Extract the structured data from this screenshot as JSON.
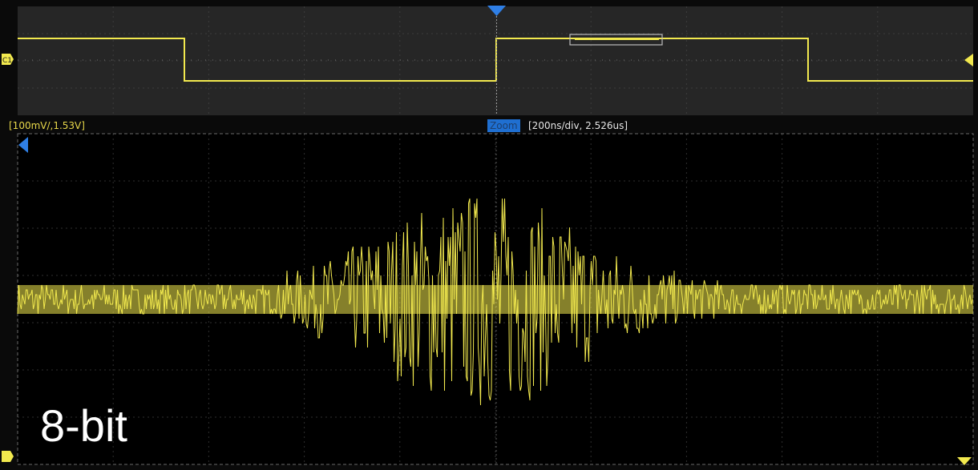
{
  "overview": {
    "marker_label": "",
    "channel_tag": "C1"
  },
  "zoom_header": {
    "channel_scale": "[100mV/,1.53V]",
    "zoom_label": "Zoom",
    "timebase": "[200ns/div, 2.526us]"
  },
  "annotation": {
    "bit_depth": "8-bit"
  },
  "colors": {
    "trace": "#f2e94e",
    "grid": "#3a3a3a",
    "zoom_badge": "#1f6fd1",
    "trigger_marker": "#2f7fe6",
    "background": "#0a0a0a"
  },
  "icons": [
    "trigger-marker-icon",
    "channel-1-icon",
    "level-arrow-icon",
    "zoom-position-icon",
    "scroll-down-icon"
  ]
}
